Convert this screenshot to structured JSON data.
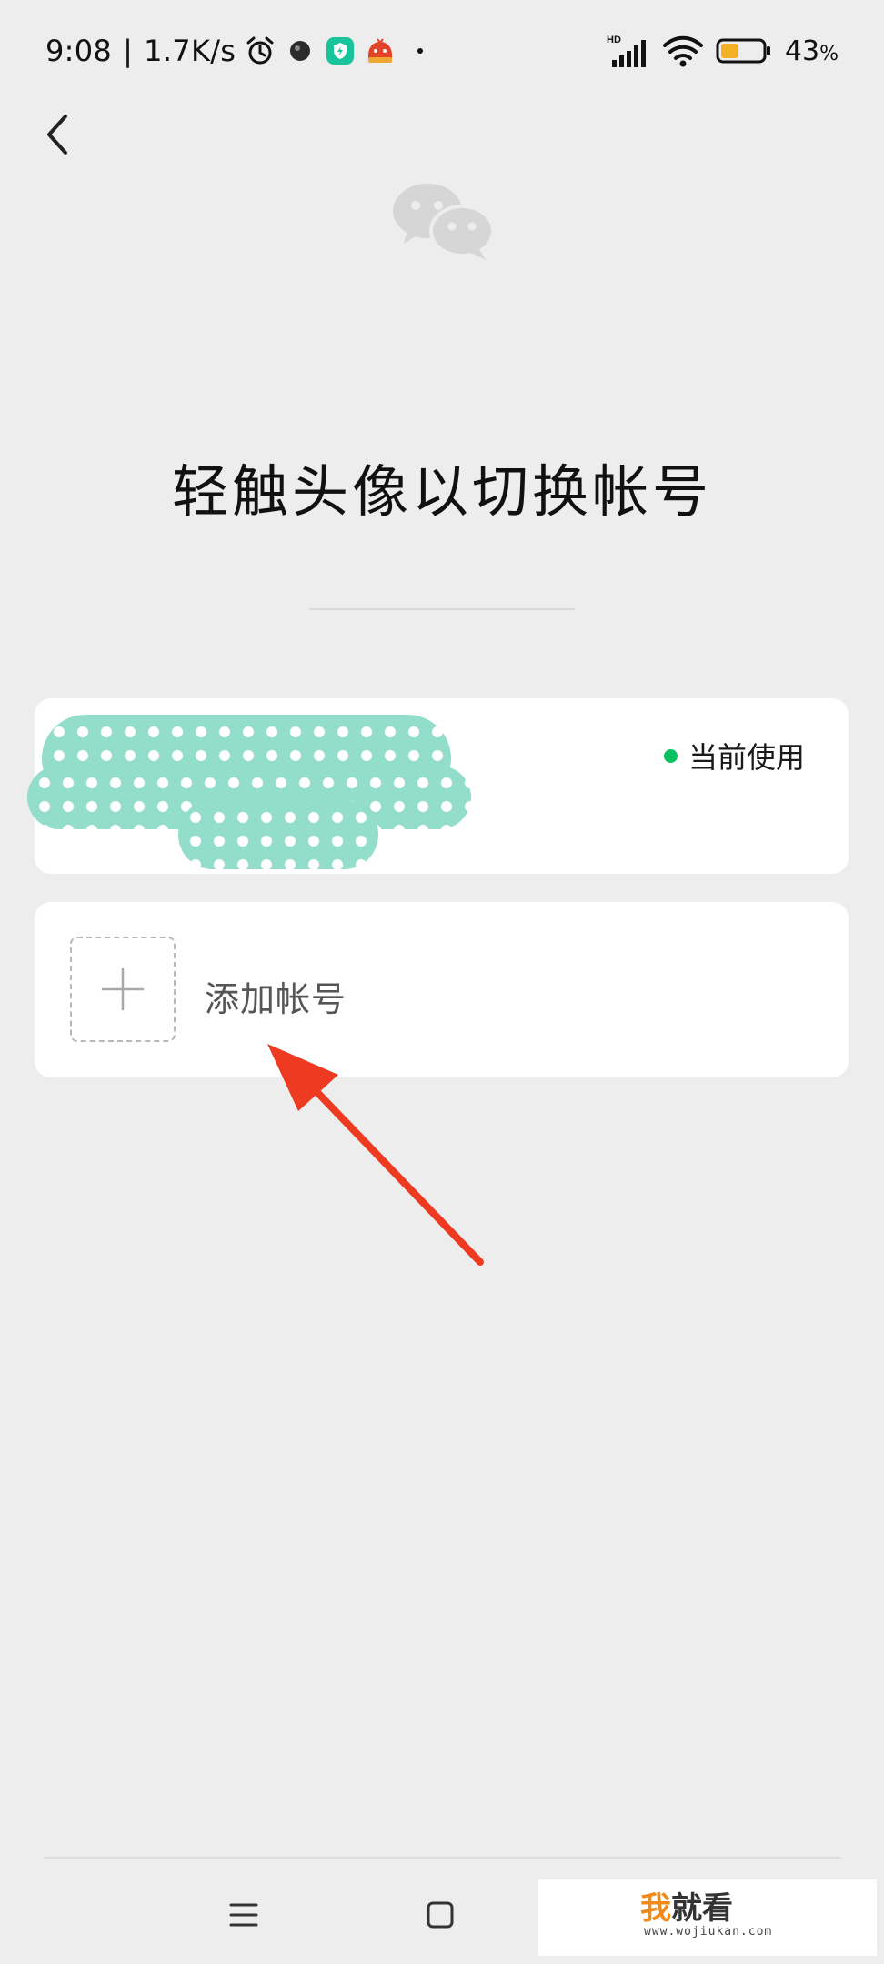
{
  "status_bar": {
    "time": "9:08",
    "network_speed": "1.7K/s",
    "network_type": "HD",
    "battery_percent": "43",
    "battery_unit": "%",
    "battery_level": 0.43,
    "icons": [
      "alarm-icon",
      "app-notification-icon",
      "security-app-icon",
      "browser-app-icon",
      "more-dot-icon",
      "signal-icon",
      "wifi-icon",
      "battery-icon"
    ]
  },
  "header": {
    "back_icon": "chevron-left-icon",
    "logo_icon": "wechat-icon"
  },
  "main": {
    "title": "轻触头像以切换帐号",
    "current_account": {
      "status_label": "当前使用",
      "status_color": "#07c160"
    },
    "add_account": {
      "label": "添加帐号",
      "icon": "plus-icon"
    }
  },
  "annotation": {
    "arrow_color": "#ee3a21"
  },
  "nav_bar": {
    "icons": [
      "menu-icon",
      "home-square-icon"
    ]
  },
  "watermark": {
    "brand_part1": "我",
    "brand_part2": "就看",
    "url": "www.wojiukan.com"
  }
}
